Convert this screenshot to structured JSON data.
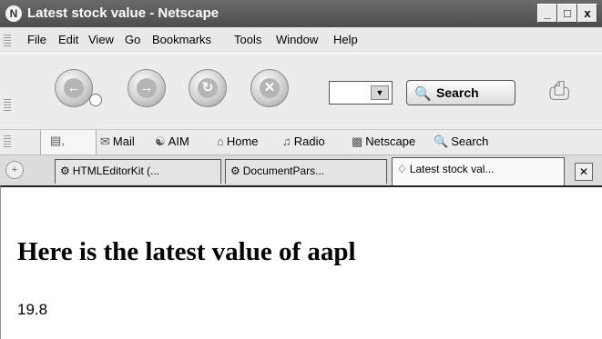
{
  "window": {
    "title": "Latest stock value - Netscape",
    "buttons": {
      "minimize": "_",
      "maximize": "□",
      "close": "x"
    }
  },
  "menu": {
    "items": [
      "File",
      "Edit",
      "View",
      "Go",
      "Bookmarks",
      "Tools",
      "Window",
      "Help"
    ]
  },
  "toolbar": {
    "search_label": "Search"
  },
  "personal_toolbar": {
    "items": [
      "Mail",
      "AIM",
      "Home",
      "Radio",
      "Netscape",
      "Search"
    ]
  },
  "tabs": {
    "items": [
      "HTMLEditorKit (...",
      "DocumentPars...",
      "Latest stock val..."
    ],
    "active_index": 2
  },
  "page": {
    "heading": "Here is the latest value of aapl",
    "value": "19.8"
  }
}
